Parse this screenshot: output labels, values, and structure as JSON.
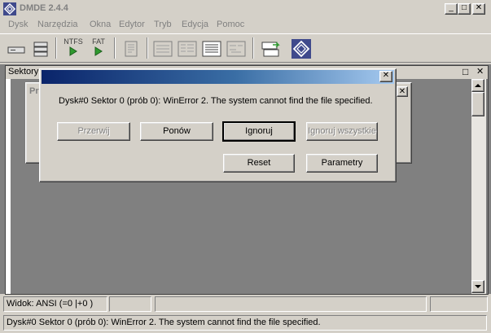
{
  "window": {
    "title": "DMDE 2.4.4",
    "min_label": "_",
    "max_label": "□",
    "close_label": "✕"
  },
  "menu": {
    "items": [
      "Dysk",
      "Narzędzia",
      "Okna",
      "Edytor",
      "Tryb",
      "Edycja",
      "Pomoc"
    ]
  },
  "toolbar": {
    "ntfs_label": "NTFS",
    "fat_label": "FAT"
  },
  "sektory": {
    "title": "Sektory",
    "min_label": "□",
    "close_label": "✕",
    "child_title": "Pr"
  },
  "dialog": {
    "message": "Dysk#0 Sektor 0 (prób 0): WinError 2. The system cannot find the file specified.",
    "close_label": "✕",
    "buttons": {
      "abort": "Przerwij",
      "retry": "Ponów",
      "ignore": "Ignoruj",
      "ignore_all": "Ignoruj wszystkie",
      "reset": "Reset",
      "params": "Parametry"
    }
  },
  "status": {
    "view": "Widok: ANSI (=0  |+0  )",
    "message": "Dysk#0 Sektor 0 (prób 0): WinError 2. The system cannot find the file specified."
  },
  "colors": {
    "dialog_title_start": "#0a246a",
    "dialog_title_end": "#a6caf0",
    "mdi_background": "#808080",
    "face": "#d4d0c8"
  }
}
